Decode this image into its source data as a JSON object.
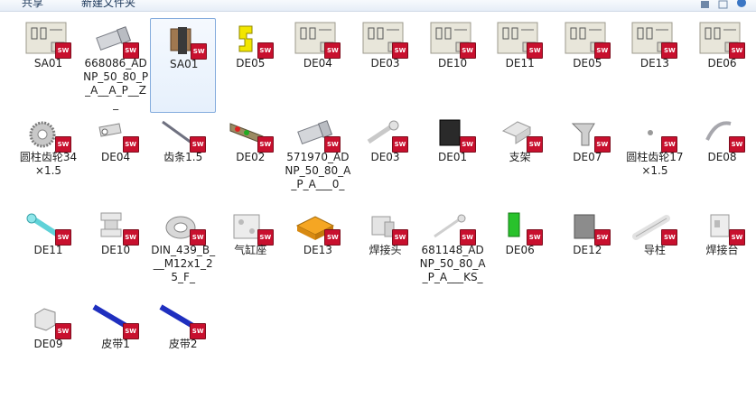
{
  "toolbar": {
    "share_label": "共享",
    "new_folder_label": "新建文件夹"
  },
  "badge_text": "SW",
  "colors": {
    "selection_border": "#84acdd",
    "sw_badge": "#c8102e",
    "text": "#1e1e1e"
  },
  "files": [
    {
      "name": "SA01",
      "icon": "drawing-sheet-icon"
    },
    {
      "name": "668086_ADNP_50_80_P_A__A_P__Z_",
      "icon": "cylinder-part-icon"
    },
    {
      "name": "SA01",
      "icon": "assembly-icon",
      "selected": true
    },
    {
      "name": "DE05",
      "icon": "yellow-bracket-icon"
    },
    {
      "name": "DE04",
      "icon": "drawing-sheet-icon"
    },
    {
      "name": "DE03",
      "icon": "drawing-sheet-icon"
    },
    {
      "name": "DE10",
      "icon": "drawing-sheet-icon"
    },
    {
      "name": "DE11",
      "icon": "drawing-sheet-icon"
    },
    {
      "name": "DE05",
      "icon": "drawing-sheet-icon"
    },
    {
      "name": "DE13",
      "icon": "drawing-sheet-icon"
    },
    {
      "name": "DE06",
      "icon": "drawing-sheet-icon"
    },
    {
      "name": "圆柱齿轮34×1.5",
      "icon": "gear-icon"
    },
    {
      "name": "DE04",
      "icon": "lever-part-icon"
    },
    {
      "name": "齿条1.5",
      "icon": "rack-icon"
    },
    {
      "name": "DE02",
      "icon": "plate-part-icon"
    },
    {
      "name": "571970_ADNP_50_80_A_P_A___0_",
      "icon": "cylinder-part-icon"
    },
    {
      "name": "DE03",
      "icon": "shaft-icon"
    },
    {
      "name": "DE01",
      "icon": "black-block-icon"
    },
    {
      "name": "支架",
      "icon": "bracket-icon"
    },
    {
      "name": "DE07",
      "icon": "clamp-icon"
    },
    {
      "name": "圆柱齿轮17×1.5",
      "icon": "small-dot-icon"
    },
    {
      "name": "DE08",
      "icon": "ring-part-icon"
    },
    {
      "name": "DE11",
      "icon": "cyan-link-icon"
    },
    {
      "name": "DE10",
      "icon": "spool-icon"
    },
    {
      "name": "DIN_439_B___M12x1_25_F_",
      "icon": "nut-icon"
    },
    {
      "name": "气缸座",
      "icon": "cylinder-seat-icon"
    },
    {
      "name": "DE13",
      "icon": "orange-plate-icon"
    },
    {
      "name": "焊接头",
      "icon": "weld-head-icon"
    },
    {
      "name": "681148_ADNP_50_80_A_P_A___KS_",
      "icon": "rod-icon"
    },
    {
      "name": "DE06",
      "icon": "green-part-icon"
    },
    {
      "name": "DE12",
      "icon": "grey-plate-icon"
    },
    {
      "name": "导柱",
      "icon": "guide-pillar-icon"
    },
    {
      "name": "焊接台",
      "icon": "weld-table-icon"
    },
    {
      "name": "DE09",
      "icon": "hex-part-icon"
    },
    {
      "name": "皮带1",
      "icon": "blue-belt-icon"
    },
    {
      "name": "皮带2",
      "icon": "blue-belt-icon"
    }
  ]
}
